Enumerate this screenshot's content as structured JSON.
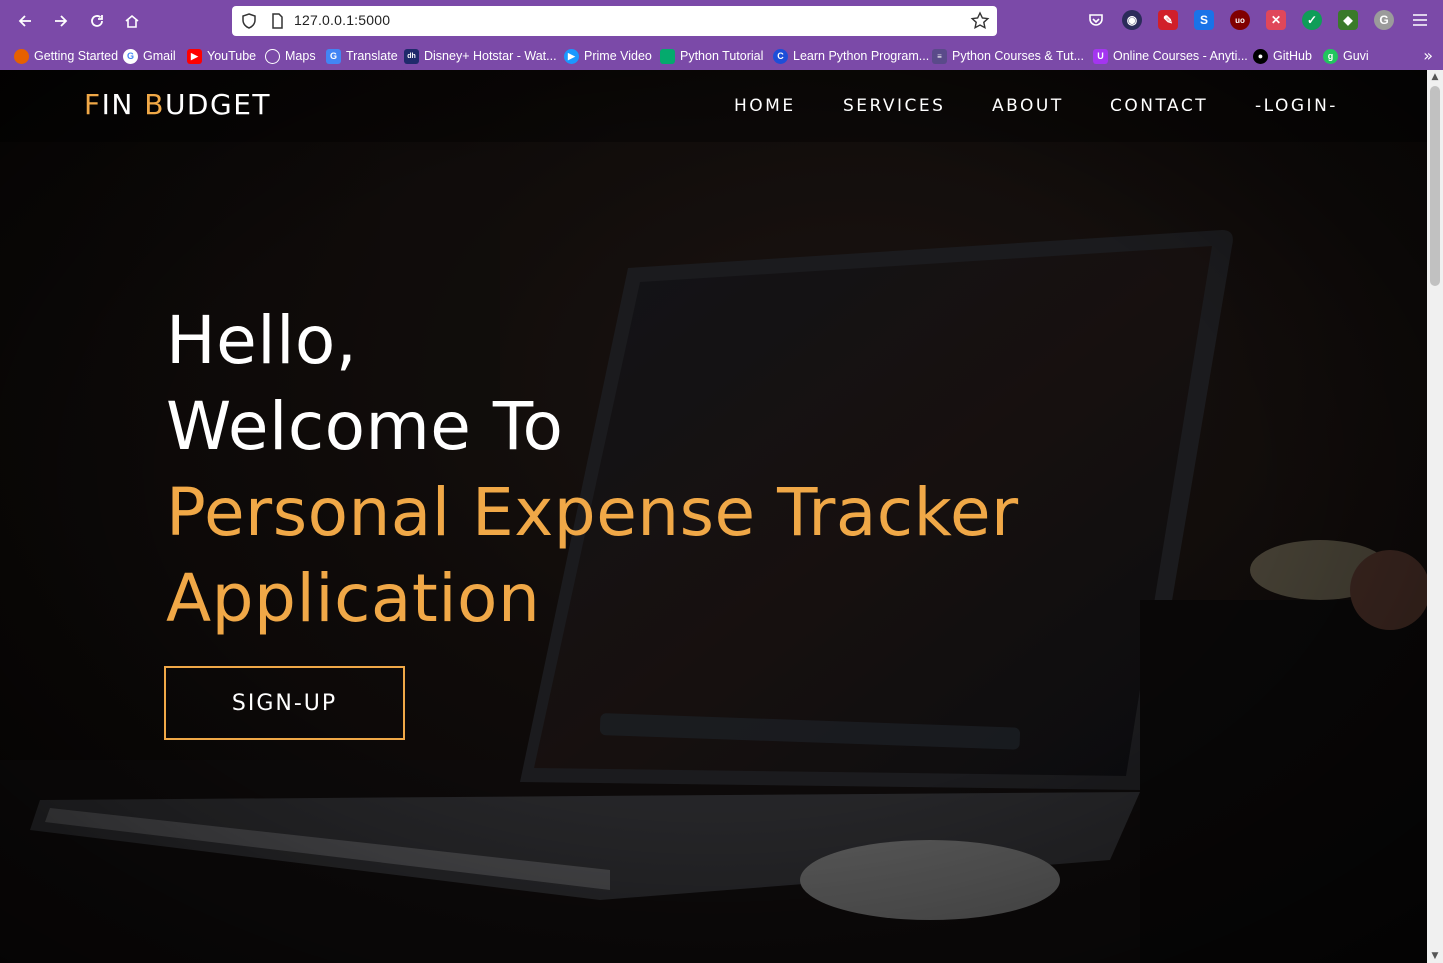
{
  "browser": {
    "url": "127.0.0.1:5000",
    "bookmarks": [
      {
        "label": "Getting Started",
        "icon": "firefox-icon",
        "color": "#e66000"
      },
      {
        "label": "Gmail",
        "icon": "google-icon",
        "color": "#ffffff"
      },
      {
        "label": "YouTube",
        "icon": "youtube-icon",
        "color": "#ff0000"
      },
      {
        "label": "Maps",
        "icon": "globe-icon",
        "color": "#ffffff"
      },
      {
        "label": "Translate",
        "icon": "translate-icon",
        "color": "#4285f4"
      },
      {
        "label": "Disney+ Hotstar - Wat...",
        "icon": "hotstar-icon",
        "color": "#1f2a6b"
      },
      {
        "label": "Prime Video",
        "icon": "prime-video-icon",
        "color": "#1a98ff"
      },
      {
        "label": "Python Tutorial",
        "icon": "python-icon",
        "color": "#04aa6d"
      },
      {
        "label": "Learn Python Program...",
        "icon": "c-icon",
        "color": "#1d4ed8"
      },
      {
        "label": "Python Courses & Tut...",
        "icon": "page-icon",
        "color": "#5a4a8a"
      },
      {
        "label": "Online Courses - Anyti...",
        "icon": "udemy-icon",
        "color": "#a435f0"
      },
      {
        "label": "GitHub",
        "icon": "github-icon",
        "color": "#000000"
      },
      {
        "label": "Guvi",
        "icon": "guvi-icon",
        "color": "#22c55e"
      }
    ]
  },
  "site": {
    "brand_first_letter": "F",
    "brand_first_rest": "IN ",
    "brand_second_letter": "B",
    "brand_second_rest": "UDGET",
    "nav": {
      "home": "HOME",
      "services": "SERVICES",
      "about": "ABOUT",
      "contact": "CONTACT",
      "login": "-LOGIN-"
    },
    "hero": {
      "line1": "Hello,",
      "line2": "Welcome To",
      "line3": "Personal Expense Tracker",
      "line4": "Application"
    },
    "signup_label": "SIGN-UP",
    "accent_color": "#f0a847"
  }
}
